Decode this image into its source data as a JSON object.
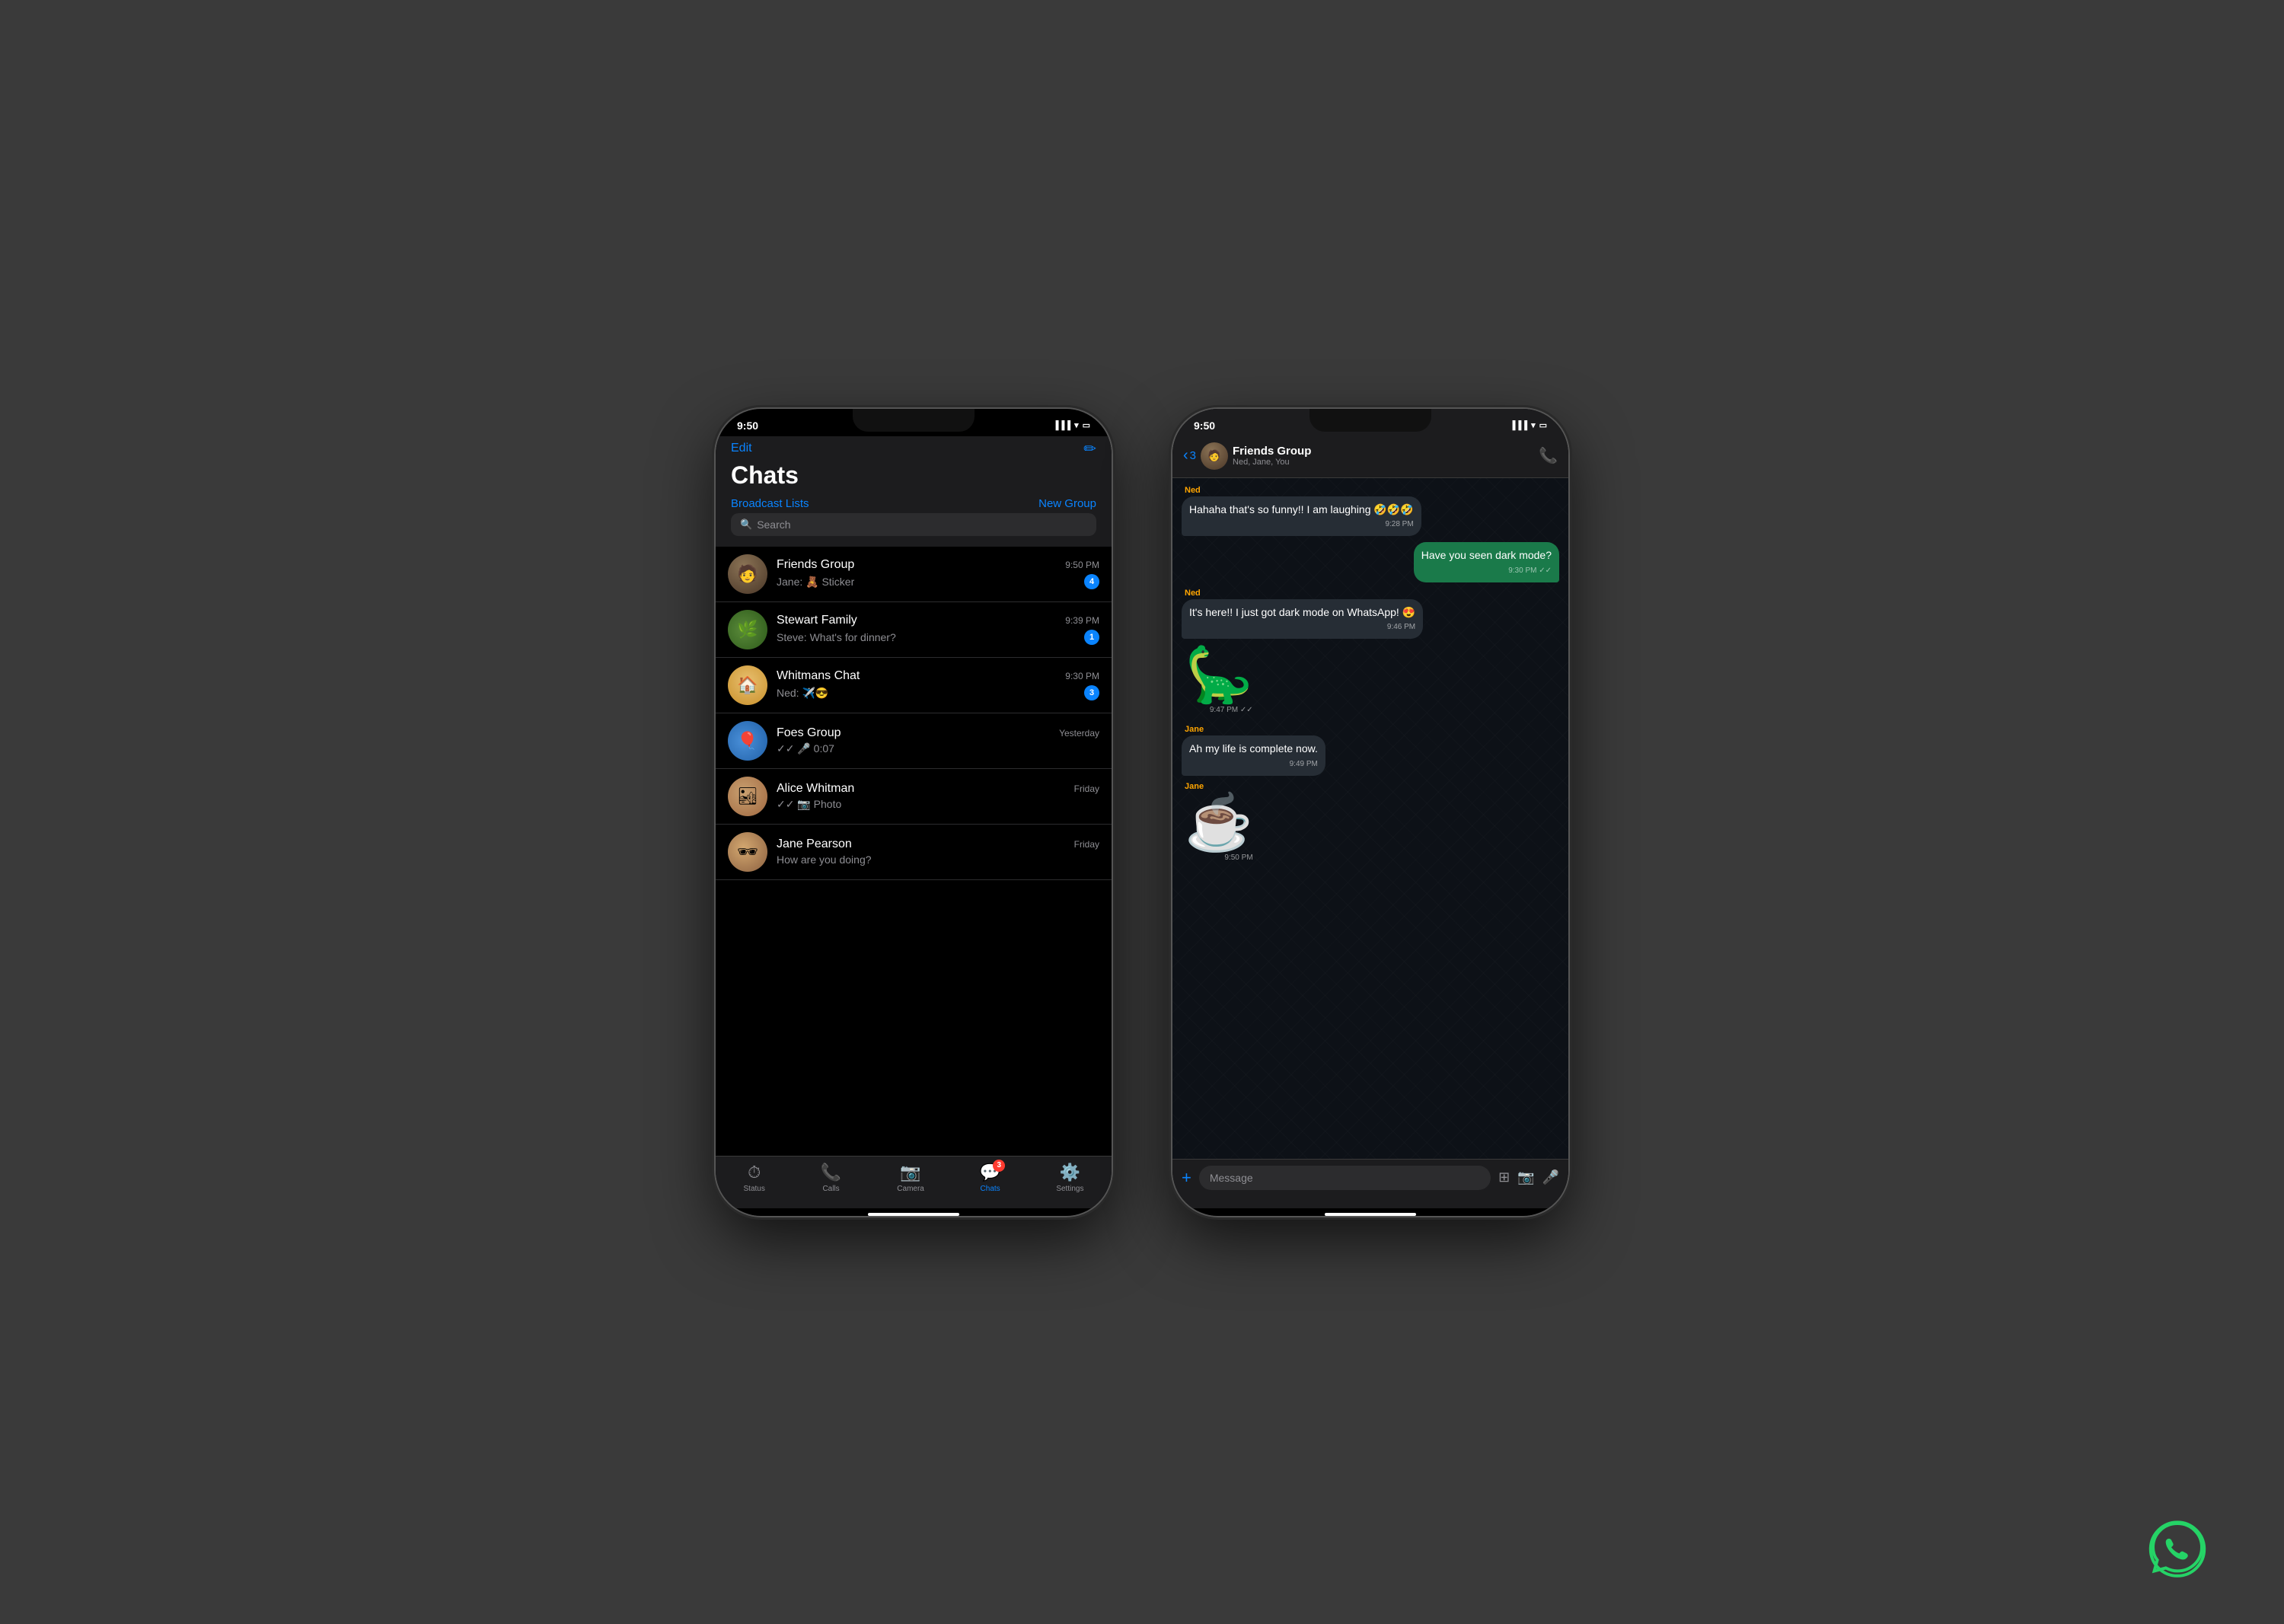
{
  "page": {
    "background": "#3a3a3a"
  },
  "phone1": {
    "status_bar": {
      "time": "9:50",
      "signal": "●●●●",
      "wifi": "WiFi",
      "battery": "Battery"
    },
    "header": {
      "edit_label": "Edit",
      "compose_icon": "✎",
      "title": "Chats",
      "broadcast_label": "Broadcast Lists",
      "newgroup_label": "New Group"
    },
    "chats": [
      {
        "name": "Friends Group",
        "time": "9:50 PM",
        "preview": "Jane: 🧸 Sticker",
        "badge": "4",
        "avatar_type": "friends"
      },
      {
        "name": "Stewart Family",
        "time": "9:39 PM",
        "preview": "Steve: What's for dinner?",
        "badge": "1",
        "avatar_type": "stewart"
      },
      {
        "name": "Whitmans Chat",
        "time": "9:30 PM",
        "preview": "Ned: ✈️😎",
        "badge": "3",
        "avatar_type": "whitmans"
      },
      {
        "name": "Foes Group",
        "time": "Yesterday",
        "preview": "✓✓ 🎤 0:07",
        "badge": "",
        "avatar_type": "foes"
      },
      {
        "name": "Alice Whitman",
        "time": "Friday",
        "preview": "✓✓ 📷 Photo",
        "badge": "",
        "avatar_type": "alice"
      },
      {
        "name": "Jane Pearson",
        "time": "Friday",
        "preview": "How are you doing?",
        "badge": "",
        "avatar_type": "jane"
      }
    ],
    "tabs": [
      {
        "label": "Status",
        "icon": "⏱",
        "active": false,
        "badge": ""
      },
      {
        "label": "Calls",
        "icon": "📞",
        "active": false,
        "badge": ""
      },
      {
        "label": "Camera",
        "icon": "📷",
        "active": false,
        "badge": ""
      },
      {
        "label": "Chats",
        "icon": "💬",
        "active": true,
        "badge": "3"
      },
      {
        "label": "Settings",
        "icon": "⚙️",
        "active": false,
        "badge": ""
      }
    ]
  },
  "phone2": {
    "status_bar": {
      "time": "9:50"
    },
    "nav": {
      "back_count": "3",
      "group_name": "Friends Group",
      "group_members": "Ned, Jane, You",
      "call_icon": "📞"
    },
    "messages": [
      {
        "type": "received",
        "sender": "Ned",
        "sender_color": "ned",
        "text": "Hahaha that's so funny!! I am laughing 🤣🤣🤣",
        "time": "9:28 PM",
        "is_sticker": false
      },
      {
        "type": "sent",
        "sender": "",
        "text": "Have you seen dark mode?",
        "time": "9:30 PM",
        "is_sticker": false
      },
      {
        "type": "received",
        "sender": "Ned",
        "sender_color": "ned",
        "text": "It's here!! I just got dark mode on WhatsApp! 😍",
        "time": "9:46 PM",
        "is_sticker": false
      },
      {
        "type": "received",
        "sender": "",
        "sender_color": "",
        "text": "🦕",
        "time": "9:47 PM",
        "is_sticker": true,
        "sticker_emoji": "🦕"
      },
      {
        "type": "received",
        "sender": "Jane",
        "sender_color": "jane",
        "text": "Ah my life is complete now.",
        "time": "9:49 PM",
        "is_sticker": false
      },
      {
        "type": "received",
        "sender": "Jane",
        "sender_color": "jane",
        "text": "☕",
        "time": "9:50 PM",
        "is_sticker": true,
        "sticker_emoji": "☕"
      }
    ],
    "input": {
      "placeholder": "Message",
      "add_icon": "+",
      "attach_icon": "📎",
      "camera_icon": "📷",
      "mic_icon": "🎤"
    }
  },
  "whatsapp_logo": "WhatsApp"
}
